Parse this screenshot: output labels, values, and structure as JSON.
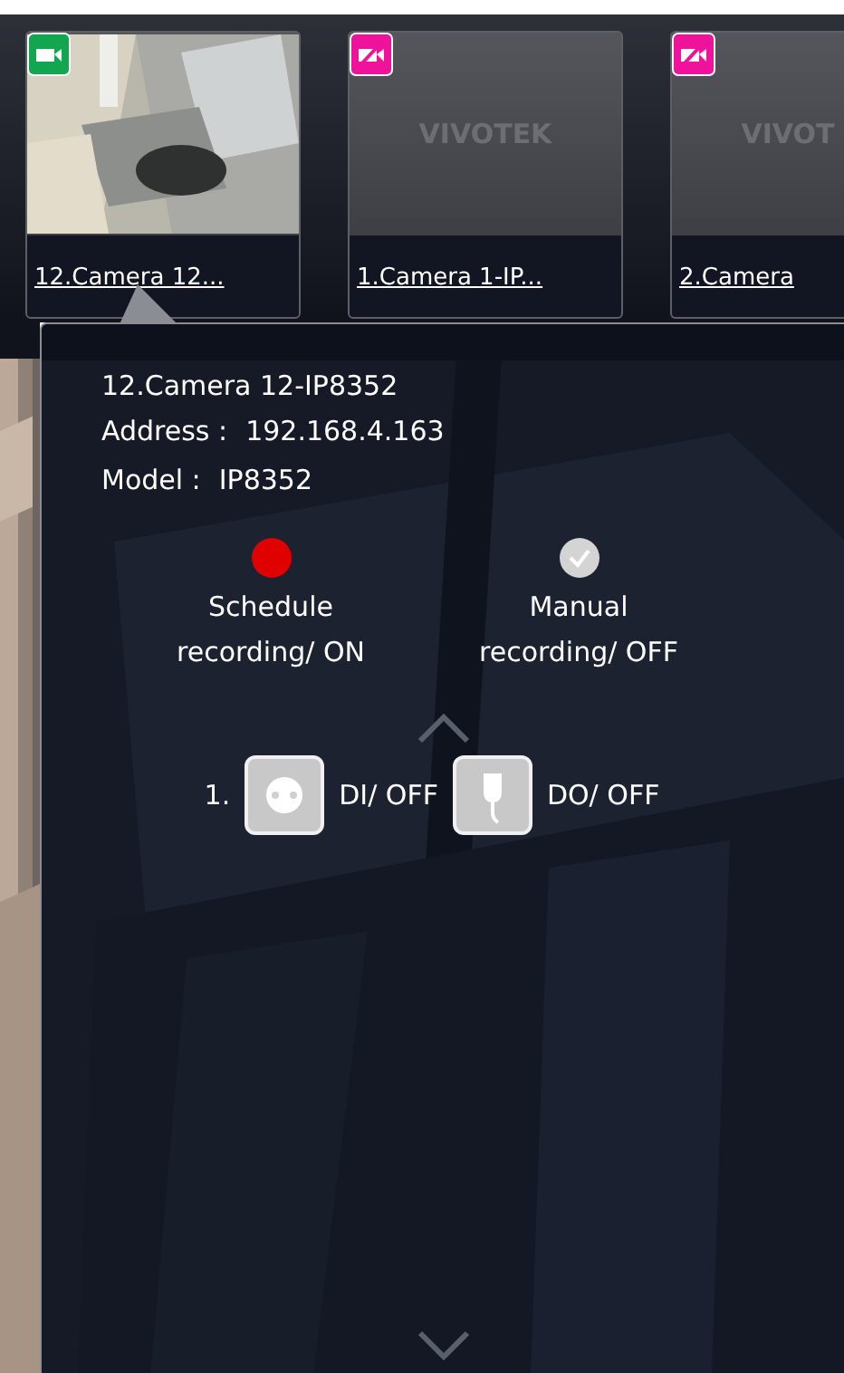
{
  "cameras": [
    {
      "name": "12.Camera 12...",
      "recording": true,
      "kind": "picture"
    },
    {
      "name": "1.Camera 1-IP...",
      "recording": false,
      "kind": "logo",
      "logo": "VIVOTEK"
    },
    {
      "name": "2.Camera",
      "recording": false,
      "kind": "logo",
      "logo": "VIVOT"
    }
  ],
  "popup": {
    "title": "12.Camera 12-IP8352",
    "details": [
      {
        "label": "Address :",
        "value": "192.168.4.163"
      },
      {
        "label": "Model :",
        "value": "IP8352"
      }
    ],
    "recordings": [
      {
        "label": "Schedule\nrecording/ ON",
        "on": true
      },
      {
        "label": "Manual\nrecording/ OFF",
        "on": false
      }
    ],
    "io": {
      "index": "1.",
      "ports": [
        {
          "kind": "di",
          "label": "DI/ OFF",
          "on": false
        },
        {
          "kind": "do",
          "label": "DO/ OFF",
          "on": false
        }
      ]
    }
  }
}
